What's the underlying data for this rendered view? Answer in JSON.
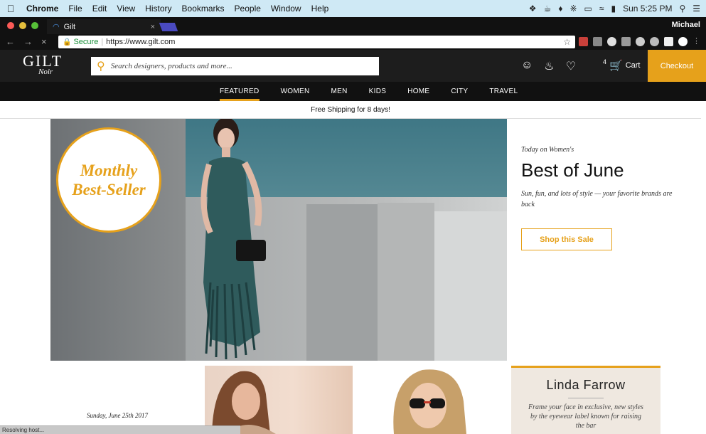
{
  "menubar": {
    "app": "Chrome",
    "items": [
      "File",
      "Edit",
      "View",
      "History",
      "Bookmarks",
      "People",
      "Window",
      "Help"
    ],
    "clock": "Sun 5:25 PM"
  },
  "browser": {
    "tab_title": "Gilt",
    "profile": "Michael",
    "secure_label": "Secure",
    "url": "https://www.gilt.com"
  },
  "header": {
    "logo": "GILT",
    "logo_sub": "Noir",
    "search_placeholder": "Search designers, products and more...",
    "cart_count": "4",
    "cart_label": "Cart",
    "checkout_label": "Checkout"
  },
  "nav": {
    "items": [
      "FEATURED",
      "WOMEN",
      "MEN",
      "KIDS",
      "HOME",
      "CITY",
      "TRAVEL"
    ],
    "active": "FEATURED"
  },
  "banner": {
    "shipping": "Free Shipping for 8 days!"
  },
  "hero": {
    "badge_line1": "Monthly",
    "badge_line2": "Best-Seller"
  },
  "promo": {
    "kicker": "Today on Women's",
    "title": "Best of June",
    "desc": "Sun, fun, and lots of style — your favorite brands are back",
    "cta": "Shop this Sale"
  },
  "bottom": {
    "date": "Sunday, June 25th 2017",
    "tile3_title": "Linda Farrow",
    "tile3_copy": "Frame your face in exclusive, new styles by the eyewear label known for raising the bar"
  },
  "status": {
    "text": "Resolving host..."
  },
  "colors": {
    "accent": "#e6a11b",
    "header_bg": "#1d1d1d",
    "nav_bg": "#111111"
  }
}
